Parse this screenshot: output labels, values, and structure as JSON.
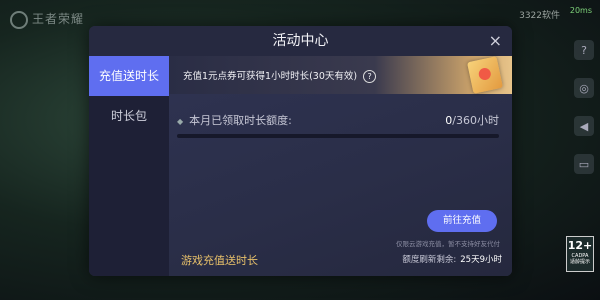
{
  "background": {
    "logo_text": "王者荣耀",
    "status_text": "3322软件",
    "ping_text": "20ms",
    "age_rating": "12+",
    "age_sub": "CADPA",
    "age_caption": "适龄提示"
  },
  "dialog": {
    "title": "活动中心",
    "close": "×"
  },
  "tabs": [
    {
      "label": "充值送时长"
    },
    {
      "label": "时长包"
    }
  ],
  "banner": {
    "text": "充值1元点券可获得1小时时长(30天有效)",
    "help": "?"
  },
  "quota": {
    "label": "本月已领取时长额度:",
    "current": "0",
    "total": "/360小时",
    "progress_fraction": 0
  },
  "actions": {
    "recharge_button": "前往充值",
    "note": "仅限云游戏充值，暂不支持好友代付"
  },
  "footer": {
    "title": "游戏充值送时长",
    "refresh_label": "额度刷新剩余:",
    "refresh_value": "25天9小时"
  },
  "colors": {
    "accent": "#5f6ef0",
    "gold": "#e7c06a",
    "panel": "#2a2d45"
  }
}
